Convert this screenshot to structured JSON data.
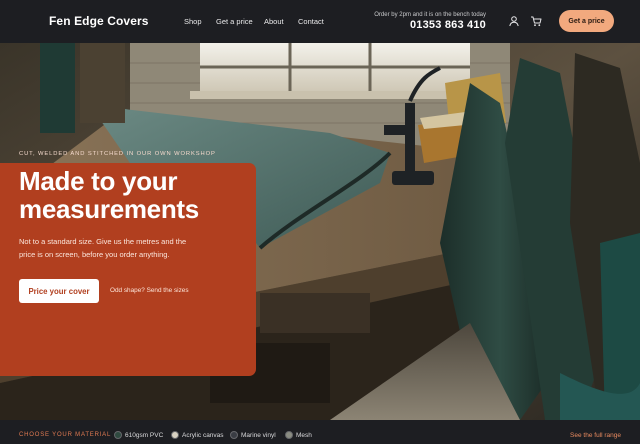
{
  "header": {
    "brand": "Fen Edge Covers",
    "nav": [
      "Shop",
      "Get a price",
      "About",
      "Contact"
    ],
    "order_note": "Order by 2pm and it is on the bench today",
    "phone": "01353 863 410",
    "cta_label": "Get a price",
    "cta_color": "#f2a97e"
  },
  "hero": {
    "eyebrow": "CUT, WELDED AND STITCHED IN OUR OWN WORKSHOP",
    "headline": "Made to your measurements",
    "subtext": "Not to a standard size. Give us the metres and the price is on screen, before you order anything.",
    "primary_label": "Price your cover",
    "secondary_label": "Odd shape? Send the sizes",
    "panel_color": "#b13f1f"
  },
  "materials": {
    "label": "CHOOSE YOUR MATERIAL",
    "options": [
      {
        "name": "610gsm PVC",
        "color": "#2f4a40"
      },
      {
        "name": "Acrylic canvas",
        "color": "#d8d2c2"
      },
      {
        "name": "Marine vinyl",
        "color": "#3a3d44"
      },
      {
        "name": "Mesh",
        "color": "#8a8c82"
      }
    ],
    "range_link": "See the full range"
  }
}
